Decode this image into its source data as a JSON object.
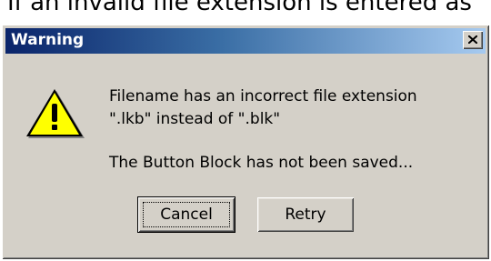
{
  "document": {
    "background_text": "If an invalid file extension is entered as"
  },
  "dialog": {
    "title": "Warning",
    "close_glyph": "close-icon",
    "icon": "warning-triangle-icon",
    "message_line1": "Filename has an incorrect file extension",
    "message_line2": "\".lkb\" instead of \".blk\"",
    "message_line3": "The Button Block has not been saved...",
    "buttons": {
      "cancel_label": "Cancel",
      "retry_label": "Retry"
    },
    "colors": {
      "titlebar_start": "#0a246a",
      "titlebar_end": "#a6caf0",
      "face": "#d4d0c8",
      "warning_yellow": "#ffff00"
    }
  }
}
